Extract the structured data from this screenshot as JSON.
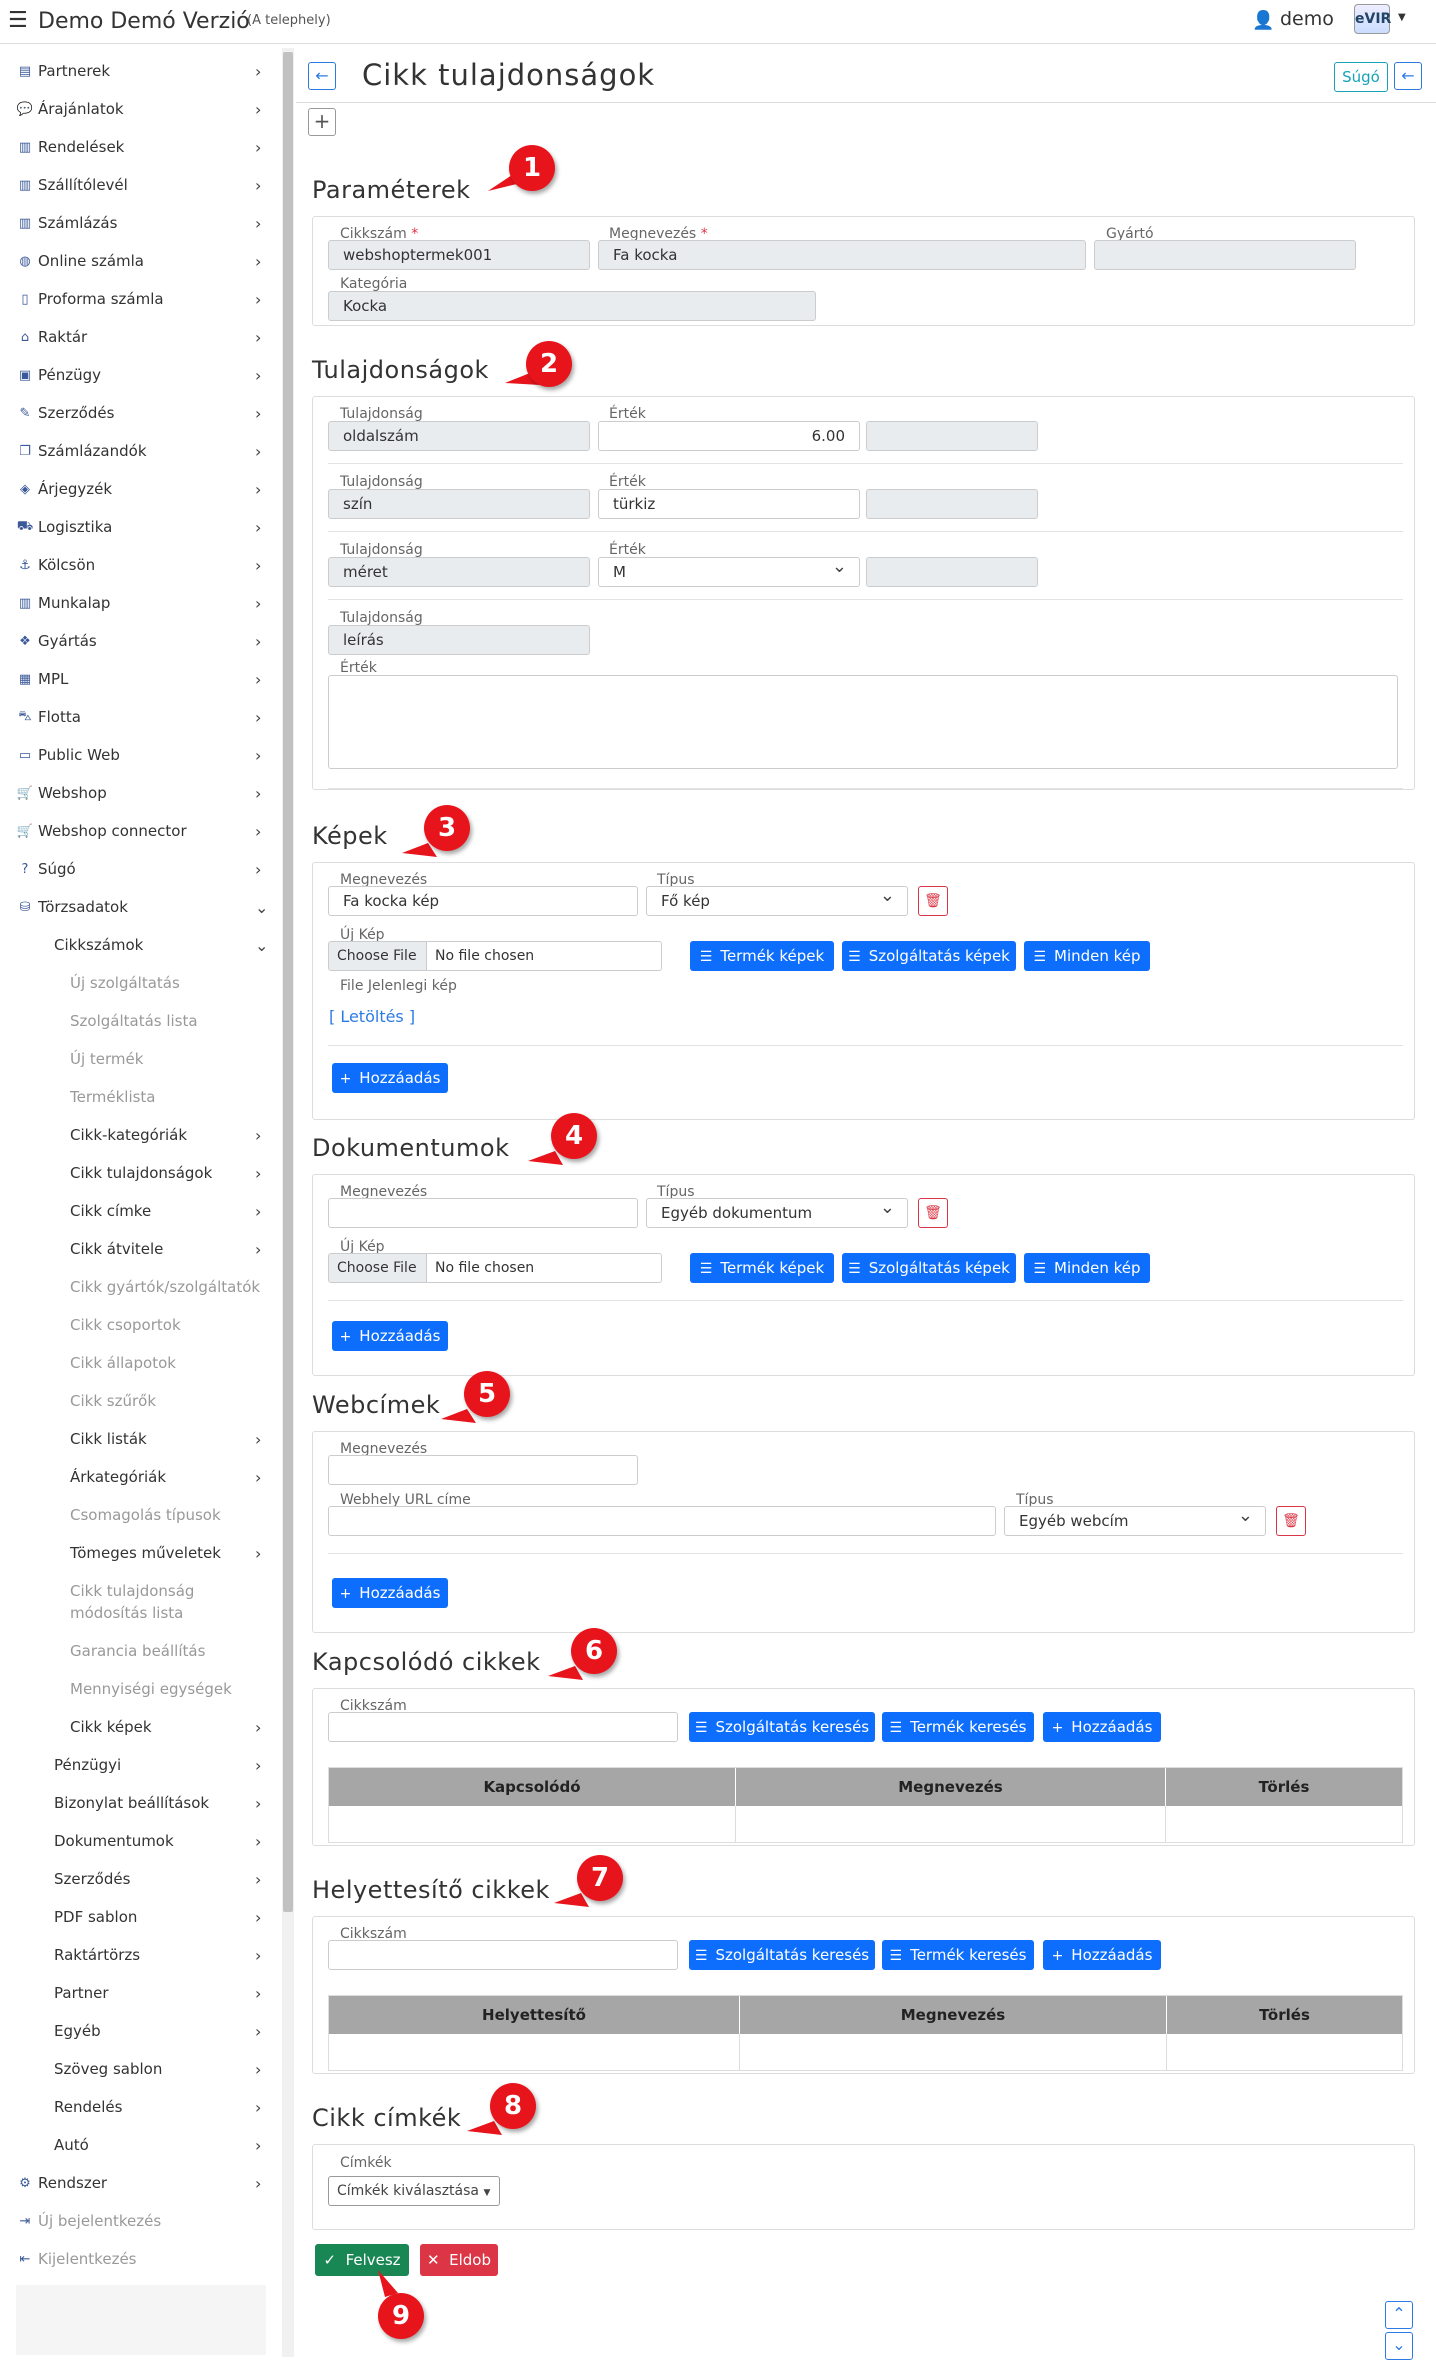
{
  "app": {
    "title": "Demo Demó Verzió",
    "subtitle": "(A telephely)",
    "user": "demo",
    "logo": "eVIR"
  },
  "sidebar": {
    "items": [
      {
        "label": "Partnerek",
        "icon": "card-icon"
      },
      {
        "label": "Árajánlatok",
        "icon": "chat-icon"
      },
      {
        "label": "Rendelések",
        "icon": "file-icon"
      },
      {
        "label": "Szállítólevél",
        "icon": "file-icon"
      },
      {
        "label": "Számlázás",
        "icon": "file-icon"
      },
      {
        "label": "Online számla",
        "icon": "globe-icon"
      },
      {
        "label": "Proforma számla",
        "icon": "file-o-icon"
      },
      {
        "label": "Raktár",
        "icon": "warehouse-icon"
      },
      {
        "label": "Pénzügy",
        "icon": "money-icon"
      },
      {
        "label": "Szerződés",
        "icon": "contract-icon"
      },
      {
        "label": "Számlázandók",
        "icon": "files-icon"
      },
      {
        "label": "Árjegyzék",
        "icon": "tags-icon"
      },
      {
        "label": "Logisztika",
        "icon": "dolly-icon"
      },
      {
        "label": "Kölcsön",
        "icon": "anchor-icon"
      },
      {
        "label": "Munkalap",
        "icon": "file-icon"
      },
      {
        "label": "Gyártás",
        "icon": "cubes-icon"
      },
      {
        "label": "MPL",
        "icon": "chart-icon"
      },
      {
        "label": "Flotta",
        "icon": "car-icon"
      },
      {
        "label": "Public Web",
        "icon": "browser-icon"
      },
      {
        "label": "Webshop",
        "icon": "cart-icon"
      },
      {
        "label": "Webshop connector",
        "icon": "cart-icon"
      },
      {
        "label": "Súgó",
        "icon": "question-icon"
      },
      {
        "label": "Törzsadatok",
        "icon": "database-icon"
      }
    ],
    "torzsadatok": [
      {
        "label": "Cikkszámok"
      },
      {
        "label": "Új szolgáltatás"
      },
      {
        "label": "Szolgáltatás lista"
      },
      {
        "label": "Új termék"
      },
      {
        "label": "Terméklista"
      },
      {
        "label": "Cikk-kategóriák"
      },
      {
        "label": "Cikk tulajdonságok"
      },
      {
        "label": "Cikk címke"
      },
      {
        "label": "Cikk átvitele"
      },
      {
        "label": "Cikk gyártók/szolgáltatók"
      },
      {
        "label": "Cikk csoportok"
      },
      {
        "label": "Cikk állapotok"
      },
      {
        "label": "Cikk szűrők"
      },
      {
        "label": "Cikk listák"
      },
      {
        "label": "Árkategóriák"
      },
      {
        "label": "Csomagolás típusok"
      },
      {
        "label": "Tömeges műveletek"
      },
      {
        "label": "Cikk tulajdonság"
      },
      {
        "label": "módosítás lista"
      },
      {
        "label": "Garancia beállítás"
      },
      {
        "label": "Mennyiségi egységek"
      },
      {
        "label": "Cikk képek"
      },
      {
        "label": "Pénzügyi"
      },
      {
        "label": "Bizonylat beállítások"
      },
      {
        "label": "Dokumentumok"
      },
      {
        "label": "Szerződés"
      },
      {
        "label": "PDF sablon"
      },
      {
        "label": "Raktártörzs"
      },
      {
        "label": "Partner"
      },
      {
        "label": "Egyéb"
      },
      {
        "label": "Szöveg sablon"
      },
      {
        "label": "Rendelés"
      },
      {
        "label": "Autó"
      }
    ],
    "bottom": [
      {
        "label": "Rendszer"
      },
      {
        "label": "Új bejelentkezés"
      },
      {
        "label": "Kijelentkezés"
      }
    ]
  },
  "page": {
    "title": "Cikk tulajdonságok",
    "help": "Súgó"
  },
  "parameterek": {
    "title": "Paraméterek",
    "cikkszam_label": "Cikkszám",
    "cikkszam": "webshoptermek001",
    "megnevezes_label": "Megnevezés",
    "megnevezes": "Fa kocka",
    "gyarto_label": "Gyártó",
    "gyarto": "",
    "kategoria_label": "Kategória",
    "kategoria": "Kocka",
    "required_mark": "*"
  },
  "tulajdonsagok": {
    "title": "Tulajdonságok",
    "prop_label": "Tulajdonság",
    "value_label": "Érték",
    "rows": [
      {
        "name": "oldalszám",
        "value": "6.00"
      },
      {
        "name": "szín",
        "value": "türkiz"
      },
      {
        "name": "méret",
        "value": "M"
      },
      {
        "name": "leírás",
        "value": ""
      }
    ]
  },
  "kepek": {
    "title": "Képek",
    "name_label": "Megnevezés",
    "name": "Fa kocka kép",
    "type_label": "Típus",
    "type": "Fő kép",
    "new_label": "Új Kép",
    "choose_file": "Choose File",
    "no_file": "No file chosen",
    "btn_product": "Termék képek",
    "btn_service": "Szolgáltatás képek",
    "btn_all": "Minden kép",
    "file_current": "File Jelenlegi kép",
    "download": "[ Letöltés ]",
    "add": "Hozzáadás"
  },
  "dokumentumok": {
    "title": "Dokumentumok",
    "name_label": "Megnevezés",
    "name": "",
    "type_label": "Típus",
    "type": "Egyéb dokumentum",
    "new_label": "Új Kép",
    "choose_file": "Choose File",
    "no_file": "No file chosen",
    "btn_product": "Termék képek",
    "btn_service": "Szolgáltatás képek",
    "btn_all": "Minden kép",
    "add": "Hozzáadás"
  },
  "webcimek": {
    "title": "Webcímek",
    "name_label": "Megnevezés",
    "name": "",
    "url_label": "Webhely URL címe",
    "url": "",
    "type_label": "Típus",
    "type": "Egyéb webcím",
    "add": "Hozzáadás"
  },
  "kapcsolodo": {
    "title": "Kapcsolódó cikkek",
    "cikkszam_label": "Cikkszám",
    "btn_service": "Szolgáltatás keresés",
    "btn_product": "Termék keresés",
    "btn_add": "Hozzáadás",
    "columns": [
      "Kapcsolódó",
      "Megnevezés",
      "Törlés"
    ]
  },
  "helyettesito": {
    "title": "Helyettesítő cikkek",
    "cikkszam_label": "Cikkszám",
    "btn_service": "Szolgáltatás keresés",
    "btn_product": "Termék keresés",
    "btn_add": "Hozzáadás",
    "columns": [
      "Helyettesítő",
      "Megnevezés",
      "Törlés"
    ]
  },
  "cimkek": {
    "title": "Cikk címkék",
    "label": "Címkék",
    "select": "Címkék kiválasztása"
  },
  "actions": {
    "save": "Felvesz",
    "discard": "Eldob"
  },
  "callouts": [
    "1",
    "2",
    "3",
    "4",
    "5",
    "6",
    "7",
    "8",
    "9"
  ],
  "colors": {
    "primary": "#0d6efd",
    "success": "#198754",
    "danger": "#dc3545",
    "info": "#17a2b8",
    "callout": "#e8141c"
  }
}
